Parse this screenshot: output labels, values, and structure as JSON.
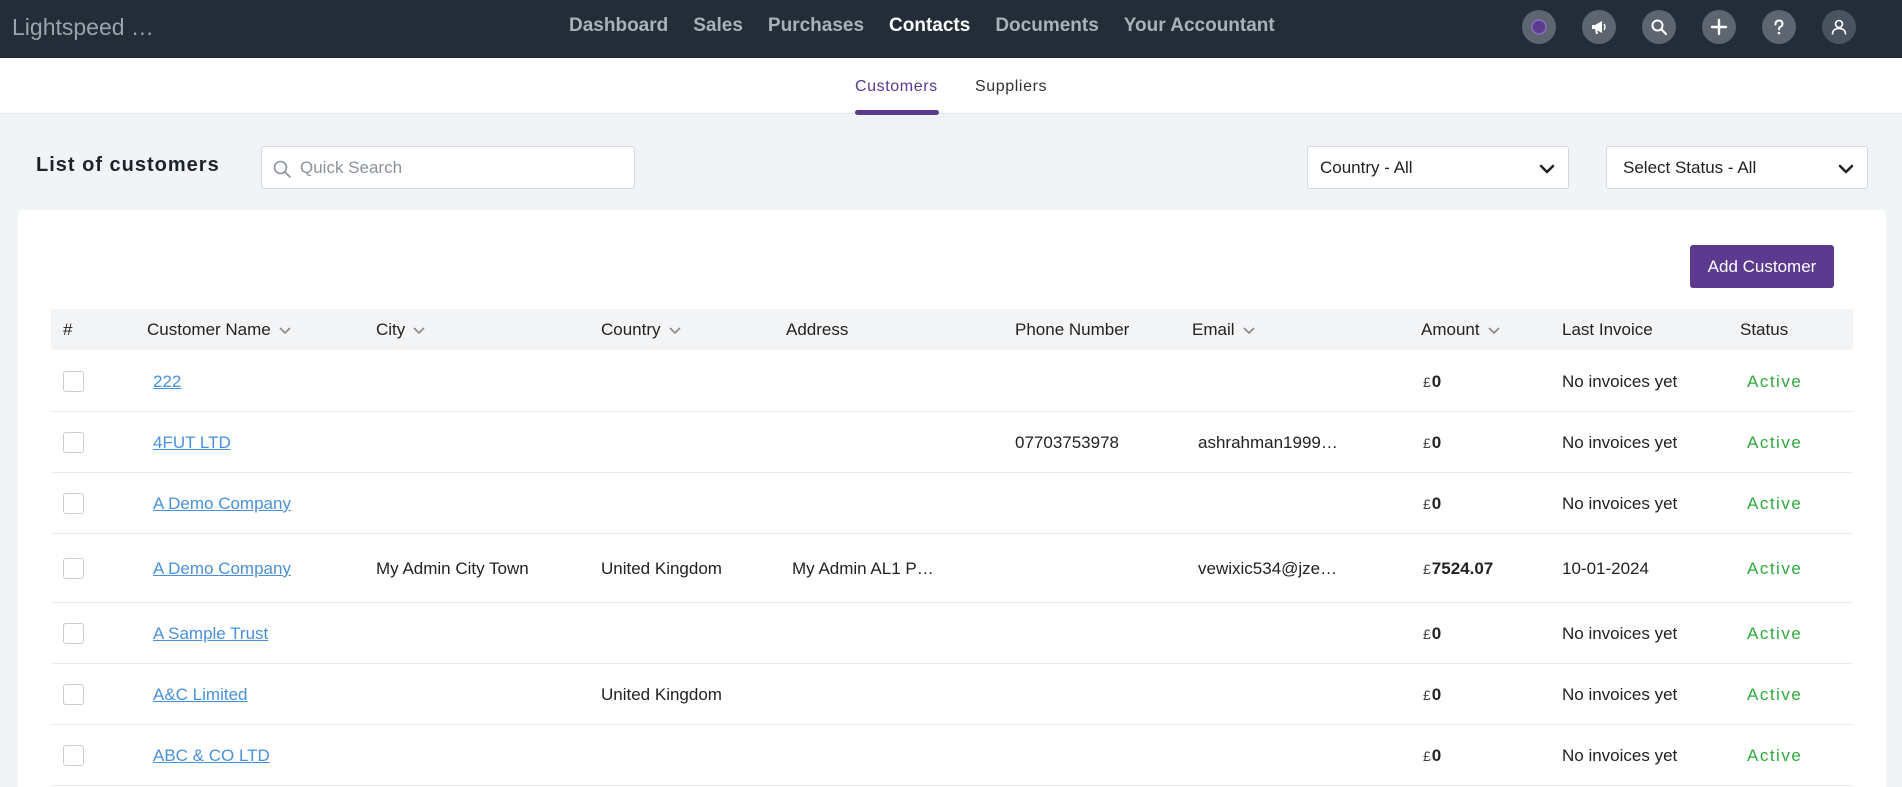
{
  "app": {
    "title": "Lightspeed …"
  },
  "nav": [
    {
      "label": "Dashboard",
      "active": false
    },
    {
      "label": "Sales",
      "active": false
    },
    {
      "label": "Purchases",
      "active": false
    },
    {
      "label": "Contacts",
      "active": true
    },
    {
      "label": "Documents",
      "active": false
    },
    {
      "label": "Your Accountant",
      "active": false
    }
  ],
  "top_icons": [
    "grammarly-icon",
    "megaphone-icon",
    "search-icon",
    "plus-icon",
    "help-icon",
    "user-icon"
  ],
  "subtabs": {
    "customers": "Customers",
    "suppliers": "Suppliers",
    "active": "Customers"
  },
  "list": {
    "title": "List of customers",
    "search_placeholder": "Quick Search",
    "country_filter": "Country - All",
    "status_filter": "Select Status - All",
    "add_button": "Add Customer"
  },
  "columns": {
    "index": "#",
    "name": "Customer Name",
    "city": "City",
    "country": "Country",
    "address": "Address",
    "phone": "Phone Number",
    "email": "Email",
    "amount": "Amount",
    "last_invoice": "Last Invoice",
    "status": "Status"
  },
  "currency_symbol": "£",
  "rows": [
    {
      "name": "222",
      "city": "",
      "country": "",
      "address": "",
      "phone": "",
      "email": "",
      "amount": "0",
      "last_invoice": "No invoices yet",
      "status": "Active"
    },
    {
      "name": "4FUT LTD",
      "city": "",
      "country": "",
      "address": "",
      "phone": "07703753978",
      "email": "ashrahman1999…",
      "amount": "0",
      "last_invoice": "No invoices yet",
      "status": "Active"
    },
    {
      "name": "A Demo Company",
      "city": "",
      "country": "",
      "address": "",
      "phone": "",
      "email": "",
      "amount": "0",
      "last_invoice": "No invoices yet",
      "status": "Active"
    },
    {
      "name": "A Demo Company",
      "city": "My Admin City Town",
      "country": "United Kingdom",
      "address": "My Admin AL1 P…",
      "phone": "",
      "email": "vewixic534@jze…",
      "amount": "7524.07",
      "last_invoice": "10-01-2024",
      "status": "Active"
    },
    {
      "name": "A Sample Trust",
      "city": "",
      "country": "",
      "address": "",
      "phone": "",
      "email": "",
      "amount": "0",
      "last_invoice": "No invoices yet",
      "status": "Active"
    },
    {
      "name": "A&C Limited",
      "city": "",
      "country": "United Kingdom",
      "address": "",
      "phone": "",
      "email": "",
      "amount": "0",
      "last_invoice": "No invoices yet",
      "status": "Active"
    },
    {
      "name": "ABC & CO LTD",
      "city": "",
      "country": "",
      "address": "",
      "phone": "",
      "email": "",
      "amount": "0",
      "last_invoice": "No invoices yet",
      "status": "Active"
    }
  ],
  "colors": {
    "brand_purple": "#5b3a8f",
    "topbar": "#232d38",
    "link": "#4a90d9",
    "active_status": "#2eaa3c"
  }
}
